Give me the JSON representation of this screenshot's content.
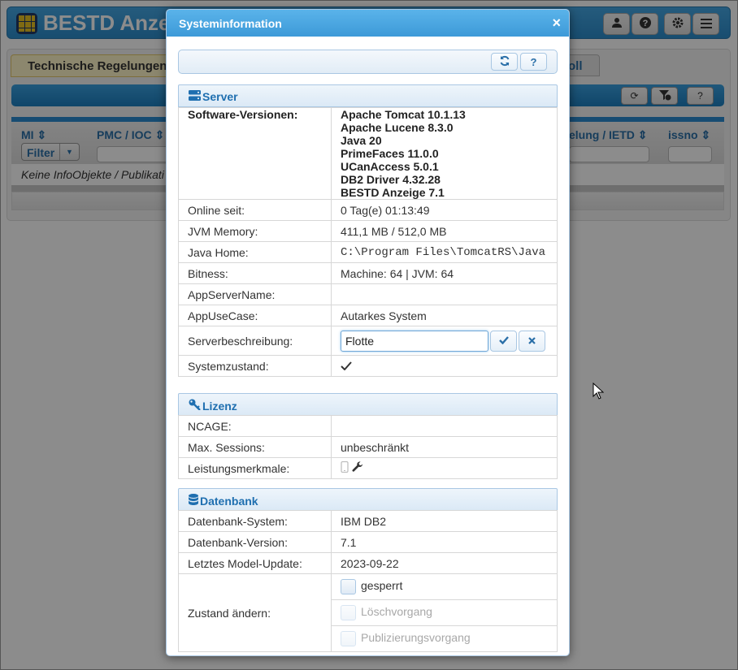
{
  "app": {
    "title": "BESTD Anze",
    "tabs": [
      "Technische Regelungen",
      "oll"
    ],
    "columns": [
      "MI",
      "PMC / IOC",
      "elung / IETD",
      "issno"
    ],
    "filter_label": "Filter",
    "empty_message": "Keine InfoObjekte / Publikati",
    "help_label": "?"
  },
  "dialog": {
    "title": "Systeminformation",
    "close_label": "×",
    "help_label": "?",
    "server": {
      "heading": "Server",
      "software_label": "Software-Versionen:",
      "software_versions": [
        "Apache Tomcat 10.1.13",
        "Apache Lucene 8.3.0",
        "Java 20",
        "PrimeFaces 11.0.0",
        "UCanAccess 5.0.1",
        "DB2 Driver 4.32.28",
        "BESTD Anzeige 7.1"
      ],
      "online_label": "Online seit:",
      "online_value": "0 Tag(e) 01:13:49",
      "jvm_label": "JVM Memory:",
      "jvm_value": "411,1 MB / 512,0 MB",
      "javahome_label": "Java Home:",
      "javahome_value": "C:\\Program Files\\TomcatRS\\Java",
      "bitness_label": "Bitness:",
      "bitness_value": "Machine: 64 | JVM: 64",
      "appservername_label": "AppServerName:",
      "appservername_value": "",
      "appusecase_label": "AppUseCase:",
      "appusecase_value": "Autarkes System",
      "description_label": "Serverbeschreibung:",
      "description_value": "Flotte",
      "state_label": "Systemzustand:"
    },
    "license": {
      "heading": "Lizenz",
      "ncage_label": "NCAGE:",
      "ncage_value": "",
      "sessions_label": "Max. Sessions:",
      "sessions_value": "unbeschränkt",
      "features_label": "Leistungsmerkmale:"
    },
    "database": {
      "heading": "Datenbank",
      "system_label": "Datenbank-System:",
      "system_value": "IBM DB2",
      "version_label": "Datenbank-Version:",
      "version_value": "7.1",
      "update_label": "Letztes Model-Update:",
      "update_value": "2023-09-22",
      "change_label": "Zustand ändern:",
      "options": [
        "gesperrt",
        "Löschvorgang",
        "Publizierungsvorgang"
      ]
    }
  },
  "colors": {
    "accent": "#3d9ad8",
    "section_text": "#1f6fb0",
    "overlay": "#8a8a8a"
  }
}
